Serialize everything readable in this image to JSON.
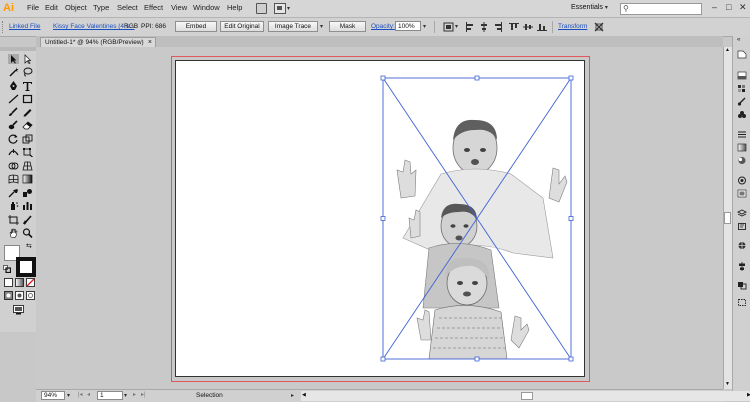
{
  "app": {
    "logo": "Ai"
  },
  "menubar": {
    "items": [
      "File",
      "Edit",
      "Object",
      "Type",
      "Select",
      "Effect",
      "View",
      "Window",
      "Help"
    ],
    "workspace": "Essentials",
    "workspace_arrow": "▾",
    "search_placeholder": "",
    "window_buttons": [
      "–",
      "□",
      "✕"
    ]
  },
  "controlbar": {
    "linked_file": "Linked File",
    "file_name": "Kissy Face Valentines (4 s...",
    "color_mode": "RGB",
    "ppi": "PPI: 686",
    "embed": "Embed",
    "edit_original": "Edit Original",
    "image_trace": "Image Trace",
    "mask": "Mask",
    "opacity_label": "Opacity:",
    "opacity_value": "100%",
    "transform": "Transform"
  },
  "document": {
    "tab_title": "Untitled-1* @ 94% (RGB/Preview)",
    "tab_close": "×"
  },
  "statusbar": {
    "zoom": "94%",
    "artboard": "1",
    "tool": "Selection"
  },
  "colors": {
    "accent": "#1a4fbf",
    "bleed": "#e0585b",
    "selection": "#3f62d8",
    "logo": "#ff9a00"
  }
}
